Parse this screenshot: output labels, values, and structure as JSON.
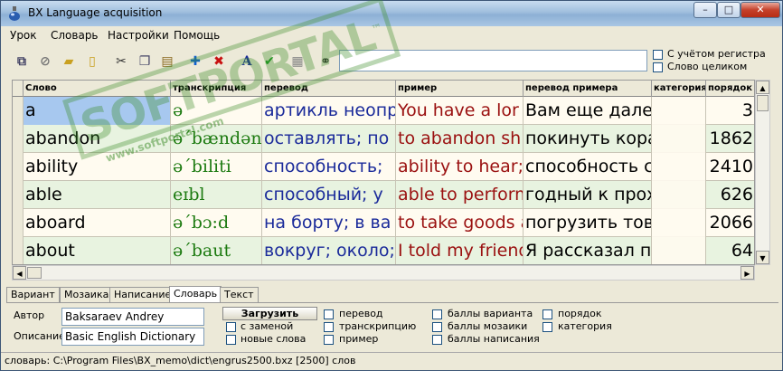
{
  "window": {
    "title": "BX Language acquisition"
  },
  "menu": [
    "Урок",
    "Словарь",
    "Настройки",
    "Помощь"
  ],
  "toolbar": {
    "search_value": "",
    "options": [
      {
        "label": "С учётом регистра",
        "checked": false
      },
      {
        "label": "Слово целиком",
        "checked": false
      }
    ]
  },
  "grid": {
    "columns": [
      "Слово",
      "транскрипция",
      "перевод",
      "пример",
      "перевод примера",
      "категория",
      "порядок"
    ],
    "rows": [
      {
        "word": "a",
        "transcription": "ə",
        "translation": "артикль неопр",
        "example": "You have a lor",
        "example_translation": "Вам еще дале",
        "category": "",
        "order": "3"
      },
      {
        "word": "abandon",
        "transcription": "ə´bændən",
        "translation": "оставлять; по",
        "example": "to abandon shi",
        "example_translation": "покинуть кора",
        "category": "",
        "order": "1862"
      },
      {
        "word": "ability",
        "transcription": "ə´biliti",
        "translation": "способность;",
        "example": "ability to hear;",
        "example_translation": "способность с",
        "category": "",
        "order": "2410"
      },
      {
        "word": "able",
        "transcription": "eɪbl",
        "translation": "способный; у",
        "example": "able to perform",
        "example_translation": "годный к прохо",
        "category": "",
        "order": "626"
      },
      {
        "word": "aboard",
        "transcription": "ə´bɔ:d",
        "translation": "на борту; в ва",
        "example": "to take goods a",
        "example_translation": "погрузить това",
        "category": "",
        "order": "2066"
      },
      {
        "word": "about",
        "transcription": "ə´baut",
        "translation": "вокруг; около;",
        "example": "I told my friend",
        "example_translation": "Я рассказал п",
        "category": "",
        "order": "64"
      }
    ]
  },
  "watermark": {
    "text": "SOFTPORTAL",
    "url": "www.softportal.com",
    "tm": "™"
  },
  "tabs": [
    "Вариант",
    "Мозаика",
    "Написание",
    "Словарь",
    "Текст"
  ],
  "active_tab": "Словарь",
  "dict_panel": {
    "author_label": "Автор",
    "author_value": "Baksaraev Andrey",
    "description_label": "Описание",
    "description_value": "Basic English Dictionary",
    "load_button": "Загрузить",
    "load_options": [
      "с заменой",
      "новые слова"
    ],
    "fields_col1": [
      "перевод",
      "транскрипцию",
      "пример"
    ],
    "fields_col2": [
      "баллы варианта",
      "баллы мозаики",
      "баллы написания"
    ],
    "fields_col3": [
      "порядок",
      "категория"
    ]
  },
  "statusbar": "словарь: C:\\Program Files\\BX_memo\\dict\\engrus2500.bxz [2500] слов",
  "colors": {
    "word": "#000000",
    "transcription": "#1c7a10",
    "translation": "#1a2a9a",
    "example": "#9a1010",
    "example_translation": "#000000"
  }
}
